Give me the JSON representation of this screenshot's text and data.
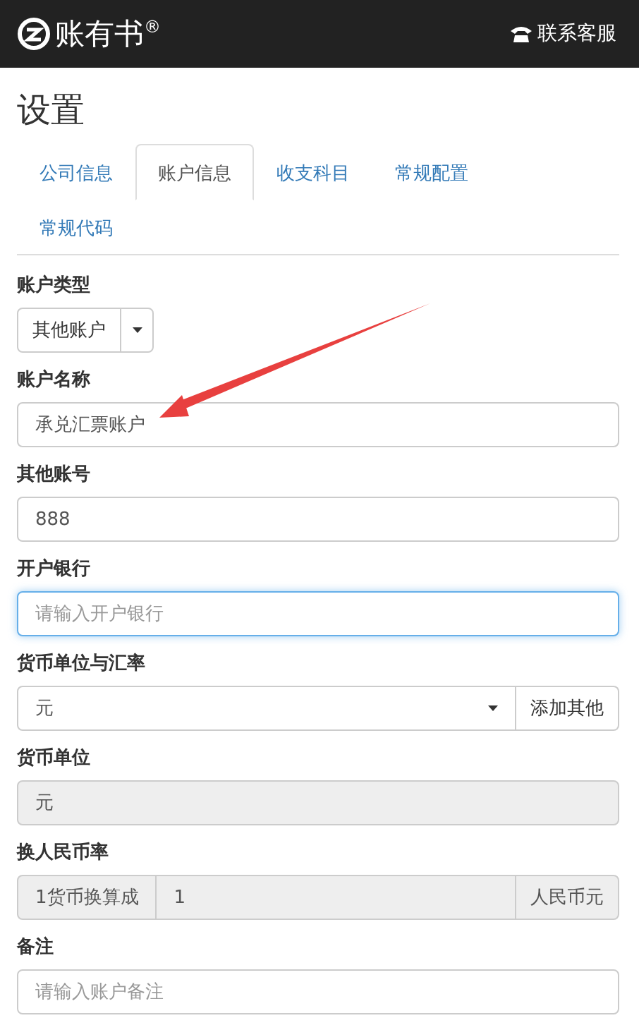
{
  "header": {
    "brand": "账有书$^{®}$",
    "support": "联系客服"
  },
  "page_title": "设置",
  "tabs": [
    {
      "label": "公司信息",
      "selected": false
    },
    {
      "label": "账户信息",
      "selected": true
    },
    {
      "label": "收支科目",
      "selected": false
    },
    {
      "label": "常规配置",
      "selected": false
    },
    {
      "label": "常规代码",
      "selected": false
    }
  ],
  "fields": [
    {
      "kind": "select",
      "label": "账户类型",
      "value": "其他账户"
    },
    {
      "kind": "text",
      "label": "账户名称",
      "value": "承兑汇票账户",
      "focused": false
    },
    {
      "kind": "text",
      "label": "其他账号",
      "value": "888",
      "focused": false
    },
    {
      "kind": "text",
      "label": "开户银行",
      "placeholder": "请输入开户银行",
      "focused": true
    },
    {
      "kind": "select-addon",
      "label": "货币单位与汇率",
      "value": "元",
      "button": "添加其他"
    },
    {
      "kind": "readonly",
      "label": "货币单位",
      "value": "元"
    },
    {
      "kind": "rate",
      "label": "换人民币率",
      "prefix": "1货币换算成",
      "value": "1",
      "suffix": "人民币元"
    },
    {
      "kind": "text",
      "label": "备注",
      "placeholder": "请输入账户备注",
      "focused": false
    }
  ],
  "annotation": {
    "kind": "arrow"
  }
}
